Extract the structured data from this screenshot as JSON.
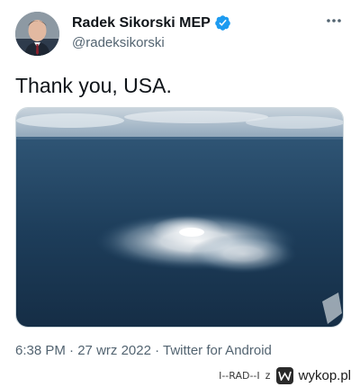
{
  "tweet": {
    "display_name": "Radek Sikorski MEP",
    "handle": "@radeksikorski",
    "text": "Thank you, USA.",
    "more_icon": "more-horizontal-icon",
    "verified_icon": "verified-badge-icon",
    "meta": {
      "time": "6:38 PM",
      "separator": " · ",
      "date": "27 wrz 2022",
      "source": "Twitter for Android"
    },
    "media_description": "aerial-sea-gas-leak-photo"
  },
  "watermark": {
    "user": "I--RAD--I",
    "connector": "z",
    "site": "wykop.pl"
  },
  "colors": {
    "text": "#0f1419",
    "secondary": "#536471",
    "verified": "#1d9bf0",
    "sea": "#1f3f5c"
  }
}
